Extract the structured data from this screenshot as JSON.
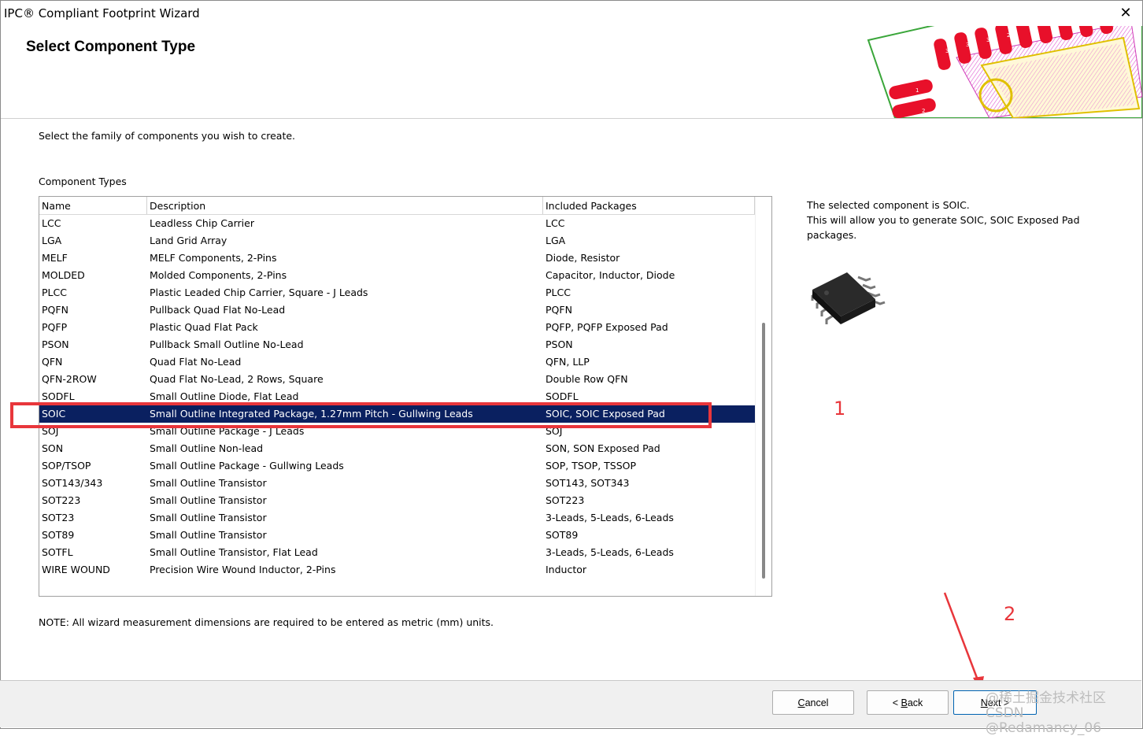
{
  "window": {
    "title": "IPC® Compliant Footprint Wizard",
    "close_glyph": "✕"
  },
  "header": {
    "title": "Select Component Type"
  },
  "instructions": "Select the family of components you wish to create.",
  "group_label": "Component Types",
  "table": {
    "columns": [
      "Name",
      "Description",
      "Included Packages"
    ],
    "selected_index": 11,
    "rows": [
      {
        "name": "LCC",
        "description": "Leadless Chip Carrier",
        "packages": "LCC"
      },
      {
        "name": "LGA",
        "description": "Land Grid Array",
        "packages": "LGA"
      },
      {
        "name": "MELF",
        "description": "MELF Components, 2-Pins",
        "packages": "Diode, Resistor"
      },
      {
        "name": "MOLDED",
        "description": "Molded Components, 2-Pins",
        "packages": "Capacitor, Inductor, Diode"
      },
      {
        "name": "PLCC",
        "description": "Plastic Leaded Chip Carrier, Square - J Leads",
        "packages": "PLCC"
      },
      {
        "name": "PQFN",
        "description": "Pullback Quad Flat No-Lead",
        "packages": "PQFN"
      },
      {
        "name": "PQFP",
        "description": "Plastic Quad Flat Pack",
        "packages": "PQFP, PQFP Exposed Pad"
      },
      {
        "name": "PSON",
        "description": "Pullback Small Outline No-Lead",
        "packages": "PSON"
      },
      {
        "name": "QFN",
        "description": "Quad Flat No-Lead",
        "packages": "QFN, LLP"
      },
      {
        "name": "QFN-2ROW",
        "description": "Quad Flat No-Lead, 2 Rows, Square",
        "packages": "Double Row QFN"
      },
      {
        "name": "SODFL",
        "description": "Small Outline Diode, Flat Lead",
        "packages": "SODFL"
      },
      {
        "name": "SOIC",
        "description": "Small Outline Integrated Package, 1.27mm Pitch - Gullwing Leads",
        "packages": "SOIC, SOIC Exposed Pad"
      },
      {
        "name": "SOJ",
        "description": "Small Outline Package - J Leads",
        "packages": "SOJ"
      },
      {
        "name": "SON",
        "description": "Small Outline Non-lead",
        "packages": "SON, SON Exposed Pad"
      },
      {
        "name": "SOP/TSOP",
        "description": "Small Outline Package - Gullwing Leads",
        "packages": "SOP, TSOP, TSSOP"
      },
      {
        "name": "SOT143/343",
        "description": "Small Outline Transistor",
        "packages": "SOT143, SOT343"
      },
      {
        "name": "SOT223",
        "description": "Small Outline Transistor",
        "packages": "SOT223"
      },
      {
        "name": "SOT23",
        "description": "Small Outline Transistor",
        "packages": "3-Leads, 5-Leads, 6-Leads"
      },
      {
        "name": "SOT89",
        "description": "Small Outline Transistor",
        "packages": "SOT89"
      },
      {
        "name": "SOTFL",
        "description": "Small Outline Transistor, Flat Lead",
        "packages": "3-Leads, 5-Leads, 6-Leads"
      },
      {
        "name": "WIRE WOUND",
        "description": "Precision Wire Wound Inductor, 2-Pins",
        "packages": "Inductor"
      }
    ]
  },
  "info": {
    "line1": "The selected component is SOIC.",
    "line2": "This will allow you to generate SOIC, SOIC Exposed Pad",
    "line3": "packages."
  },
  "note": "NOTE: All wizard measurement dimensions are required to be entered as metric (mm) units.",
  "annotations": {
    "label1": "1",
    "label2": "2",
    "color": "#e8363b"
  },
  "footer": {
    "cancel": {
      "pre": "",
      "key": "C",
      "post": "ancel"
    },
    "back": {
      "pre": "< ",
      "key": "B",
      "post": "ack"
    },
    "next": {
      "pre": "",
      "key": "N",
      "post": "ext >"
    }
  },
  "watermark": {
    "line1": "@稀土掘金技术社区",
    "line2": "CSDN @Redamancy_06"
  },
  "colors": {
    "selection": "#0a2060",
    "highlight": "#e8363b",
    "pad": "#e8102a",
    "accent": "#0063b1"
  },
  "pcb_pad_labels": [
    "32",
    "31",
    "30",
    "29",
    "1",
    "2"
  ],
  "icons": {
    "close": "close-icon",
    "chip": "soic-chip-icon",
    "pcb": "pcb-footprint-illustration"
  }
}
